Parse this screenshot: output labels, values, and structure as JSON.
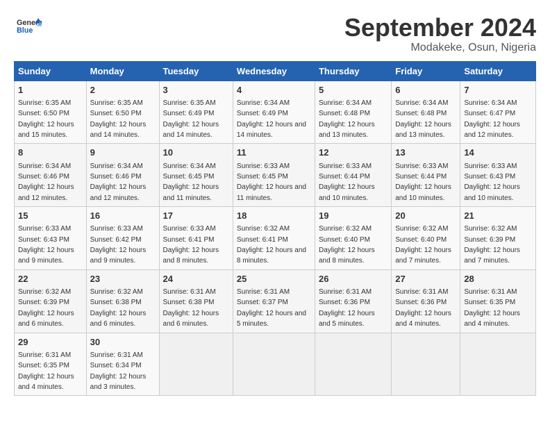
{
  "header": {
    "logo_line1": "General",
    "logo_line2": "Blue",
    "month": "September 2024",
    "location": "Modakeke, Osun, Nigeria"
  },
  "weekdays": [
    "Sunday",
    "Monday",
    "Tuesday",
    "Wednesday",
    "Thursday",
    "Friday",
    "Saturday"
  ],
  "weeks": [
    [
      {
        "day": "1",
        "sunrise": "Sunrise: 6:35 AM",
        "sunset": "Sunset: 6:50 PM",
        "daylight": "Daylight: 12 hours and 15 minutes."
      },
      {
        "day": "2",
        "sunrise": "Sunrise: 6:35 AM",
        "sunset": "Sunset: 6:50 PM",
        "daylight": "Daylight: 12 hours and 14 minutes."
      },
      {
        "day": "3",
        "sunrise": "Sunrise: 6:35 AM",
        "sunset": "Sunset: 6:49 PM",
        "daylight": "Daylight: 12 hours and 14 minutes."
      },
      {
        "day": "4",
        "sunrise": "Sunrise: 6:34 AM",
        "sunset": "Sunset: 6:49 PM",
        "daylight": "Daylight: 12 hours and 14 minutes."
      },
      {
        "day": "5",
        "sunrise": "Sunrise: 6:34 AM",
        "sunset": "Sunset: 6:48 PM",
        "daylight": "Daylight: 12 hours and 13 minutes."
      },
      {
        "day": "6",
        "sunrise": "Sunrise: 6:34 AM",
        "sunset": "Sunset: 6:48 PM",
        "daylight": "Daylight: 12 hours and 13 minutes."
      },
      {
        "day": "7",
        "sunrise": "Sunrise: 6:34 AM",
        "sunset": "Sunset: 6:47 PM",
        "daylight": "Daylight: 12 hours and 12 minutes."
      }
    ],
    [
      {
        "day": "8",
        "sunrise": "Sunrise: 6:34 AM",
        "sunset": "Sunset: 6:46 PM",
        "daylight": "Daylight: 12 hours and 12 minutes."
      },
      {
        "day": "9",
        "sunrise": "Sunrise: 6:34 AM",
        "sunset": "Sunset: 6:46 PM",
        "daylight": "Daylight: 12 hours and 12 minutes."
      },
      {
        "day": "10",
        "sunrise": "Sunrise: 6:34 AM",
        "sunset": "Sunset: 6:45 PM",
        "daylight": "Daylight: 12 hours and 11 minutes."
      },
      {
        "day": "11",
        "sunrise": "Sunrise: 6:33 AM",
        "sunset": "Sunset: 6:45 PM",
        "daylight": "Daylight: 12 hours and 11 minutes."
      },
      {
        "day": "12",
        "sunrise": "Sunrise: 6:33 AM",
        "sunset": "Sunset: 6:44 PM",
        "daylight": "Daylight: 12 hours and 10 minutes."
      },
      {
        "day": "13",
        "sunrise": "Sunrise: 6:33 AM",
        "sunset": "Sunset: 6:44 PM",
        "daylight": "Daylight: 12 hours and 10 minutes."
      },
      {
        "day": "14",
        "sunrise": "Sunrise: 6:33 AM",
        "sunset": "Sunset: 6:43 PM",
        "daylight": "Daylight: 12 hours and 10 minutes."
      }
    ],
    [
      {
        "day": "15",
        "sunrise": "Sunrise: 6:33 AM",
        "sunset": "Sunset: 6:43 PM",
        "daylight": "Daylight: 12 hours and 9 minutes."
      },
      {
        "day": "16",
        "sunrise": "Sunrise: 6:33 AM",
        "sunset": "Sunset: 6:42 PM",
        "daylight": "Daylight: 12 hours and 9 minutes."
      },
      {
        "day": "17",
        "sunrise": "Sunrise: 6:33 AM",
        "sunset": "Sunset: 6:41 PM",
        "daylight": "Daylight: 12 hours and 8 minutes."
      },
      {
        "day": "18",
        "sunrise": "Sunrise: 6:32 AM",
        "sunset": "Sunset: 6:41 PM",
        "daylight": "Daylight: 12 hours and 8 minutes."
      },
      {
        "day": "19",
        "sunrise": "Sunrise: 6:32 AM",
        "sunset": "Sunset: 6:40 PM",
        "daylight": "Daylight: 12 hours and 8 minutes."
      },
      {
        "day": "20",
        "sunrise": "Sunrise: 6:32 AM",
        "sunset": "Sunset: 6:40 PM",
        "daylight": "Daylight: 12 hours and 7 minutes."
      },
      {
        "day": "21",
        "sunrise": "Sunrise: 6:32 AM",
        "sunset": "Sunset: 6:39 PM",
        "daylight": "Daylight: 12 hours and 7 minutes."
      }
    ],
    [
      {
        "day": "22",
        "sunrise": "Sunrise: 6:32 AM",
        "sunset": "Sunset: 6:39 PM",
        "daylight": "Daylight: 12 hours and 6 minutes."
      },
      {
        "day": "23",
        "sunrise": "Sunrise: 6:32 AM",
        "sunset": "Sunset: 6:38 PM",
        "daylight": "Daylight: 12 hours and 6 minutes."
      },
      {
        "day": "24",
        "sunrise": "Sunrise: 6:31 AM",
        "sunset": "Sunset: 6:38 PM",
        "daylight": "Daylight: 12 hours and 6 minutes."
      },
      {
        "day": "25",
        "sunrise": "Sunrise: 6:31 AM",
        "sunset": "Sunset: 6:37 PM",
        "daylight": "Daylight: 12 hours and 5 minutes."
      },
      {
        "day": "26",
        "sunrise": "Sunrise: 6:31 AM",
        "sunset": "Sunset: 6:36 PM",
        "daylight": "Daylight: 12 hours and 5 minutes."
      },
      {
        "day": "27",
        "sunrise": "Sunrise: 6:31 AM",
        "sunset": "Sunset: 6:36 PM",
        "daylight": "Daylight: 12 hours and 4 minutes."
      },
      {
        "day": "28",
        "sunrise": "Sunrise: 6:31 AM",
        "sunset": "Sunset: 6:35 PM",
        "daylight": "Daylight: 12 hours and 4 minutes."
      }
    ],
    [
      {
        "day": "29",
        "sunrise": "Sunrise: 6:31 AM",
        "sunset": "Sunset: 6:35 PM",
        "daylight": "Daylight: 12 hours and 4 minutes."
      },
      {
        "day": "30",
        "sunrise": "Sunrise: 6:31 AM",
        "sunset": "Sunset: 6:34 PM",
        "daylight": "Daylight: 12 hours and 3 minutes."
      },
      null,
      null,
      null,
      null,
      null
    ]
  ]
}
